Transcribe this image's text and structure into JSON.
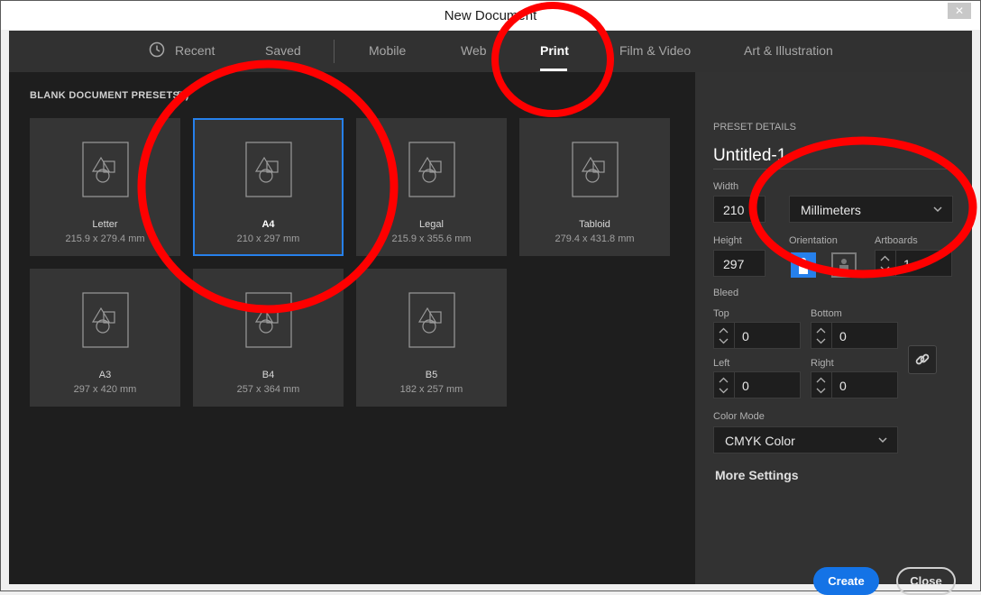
{
  "window": {
    "title": "New Document"
  },
  "tabs": [
    {
      "label": "Recent",
      "icon": "clock-icon"
    },
    {
      "label": "Saved"
    },
    {
      "label": "Mobile"
    },
    {
      "label": "Web"
    },
    {
      "label": "Print",
      "active": true
    },
    {
      "label": "Film & Video"
    },
    {
      "label": "Art & Illustration"
    }
  ],
  "presets": {
    "heading": "BLANK DOCUMENT PRESETS",
    "count": "(7)",
    "items": [
      {
        "name": "Letter",
        "size": "215.9 x 279.4 mm"
      },
      {
        "name": "A4",
        "size": "210 x 297 mm",
        "selected": true
      },
      {
        "name": "Legal",
        "size": "215.9 x 355.6 mm"
      },
      {
        "name": "Tabloid",
        "size": "279.4 x 431.8 mm"
      },
      {
        "name": "A3",
        "size": "297 x 420 mm"
      },
      {
        "name": "B4",
        "size": "257 x 364 mm"
      },
      {
        "name": "B5",
        "size": "182 x 257 mm"
      }
    ]
  },
  "details": {
    "heading": "PRESET DETAILS",
    "name": "Untitled-1",
    "width_label": "Width",
    "width": "210",
    "units": "Millimeters",
    "height_label": "Height",
    "height": "297",
    "orientation_label": "Orientation",
    "orientation": "portrait",
    "artboards_label": "Artboards",
    "artboards": "1",
    "bleed_label": "Bleed",
    "bleed": {
      "top_label": "Top",
      "top": "0",
      "bottom_label": "Bottom",
      "bottom": "0",
      "left_label": "Left",
      "left": "0",
      "right_label": "Right",
      "right": "0"
    },
    "color_mode_label": "Color Mode",
    "color_mode": "CMYK Color",
    "more_settings": "More Settings",
    "create_label": "Create",
    "close_label": "Close"
  },
  "colors": {
    "accent": "#1473e6",
    "selection": "#2680eb",
    "annotation": "#ff0000"
  }
}
